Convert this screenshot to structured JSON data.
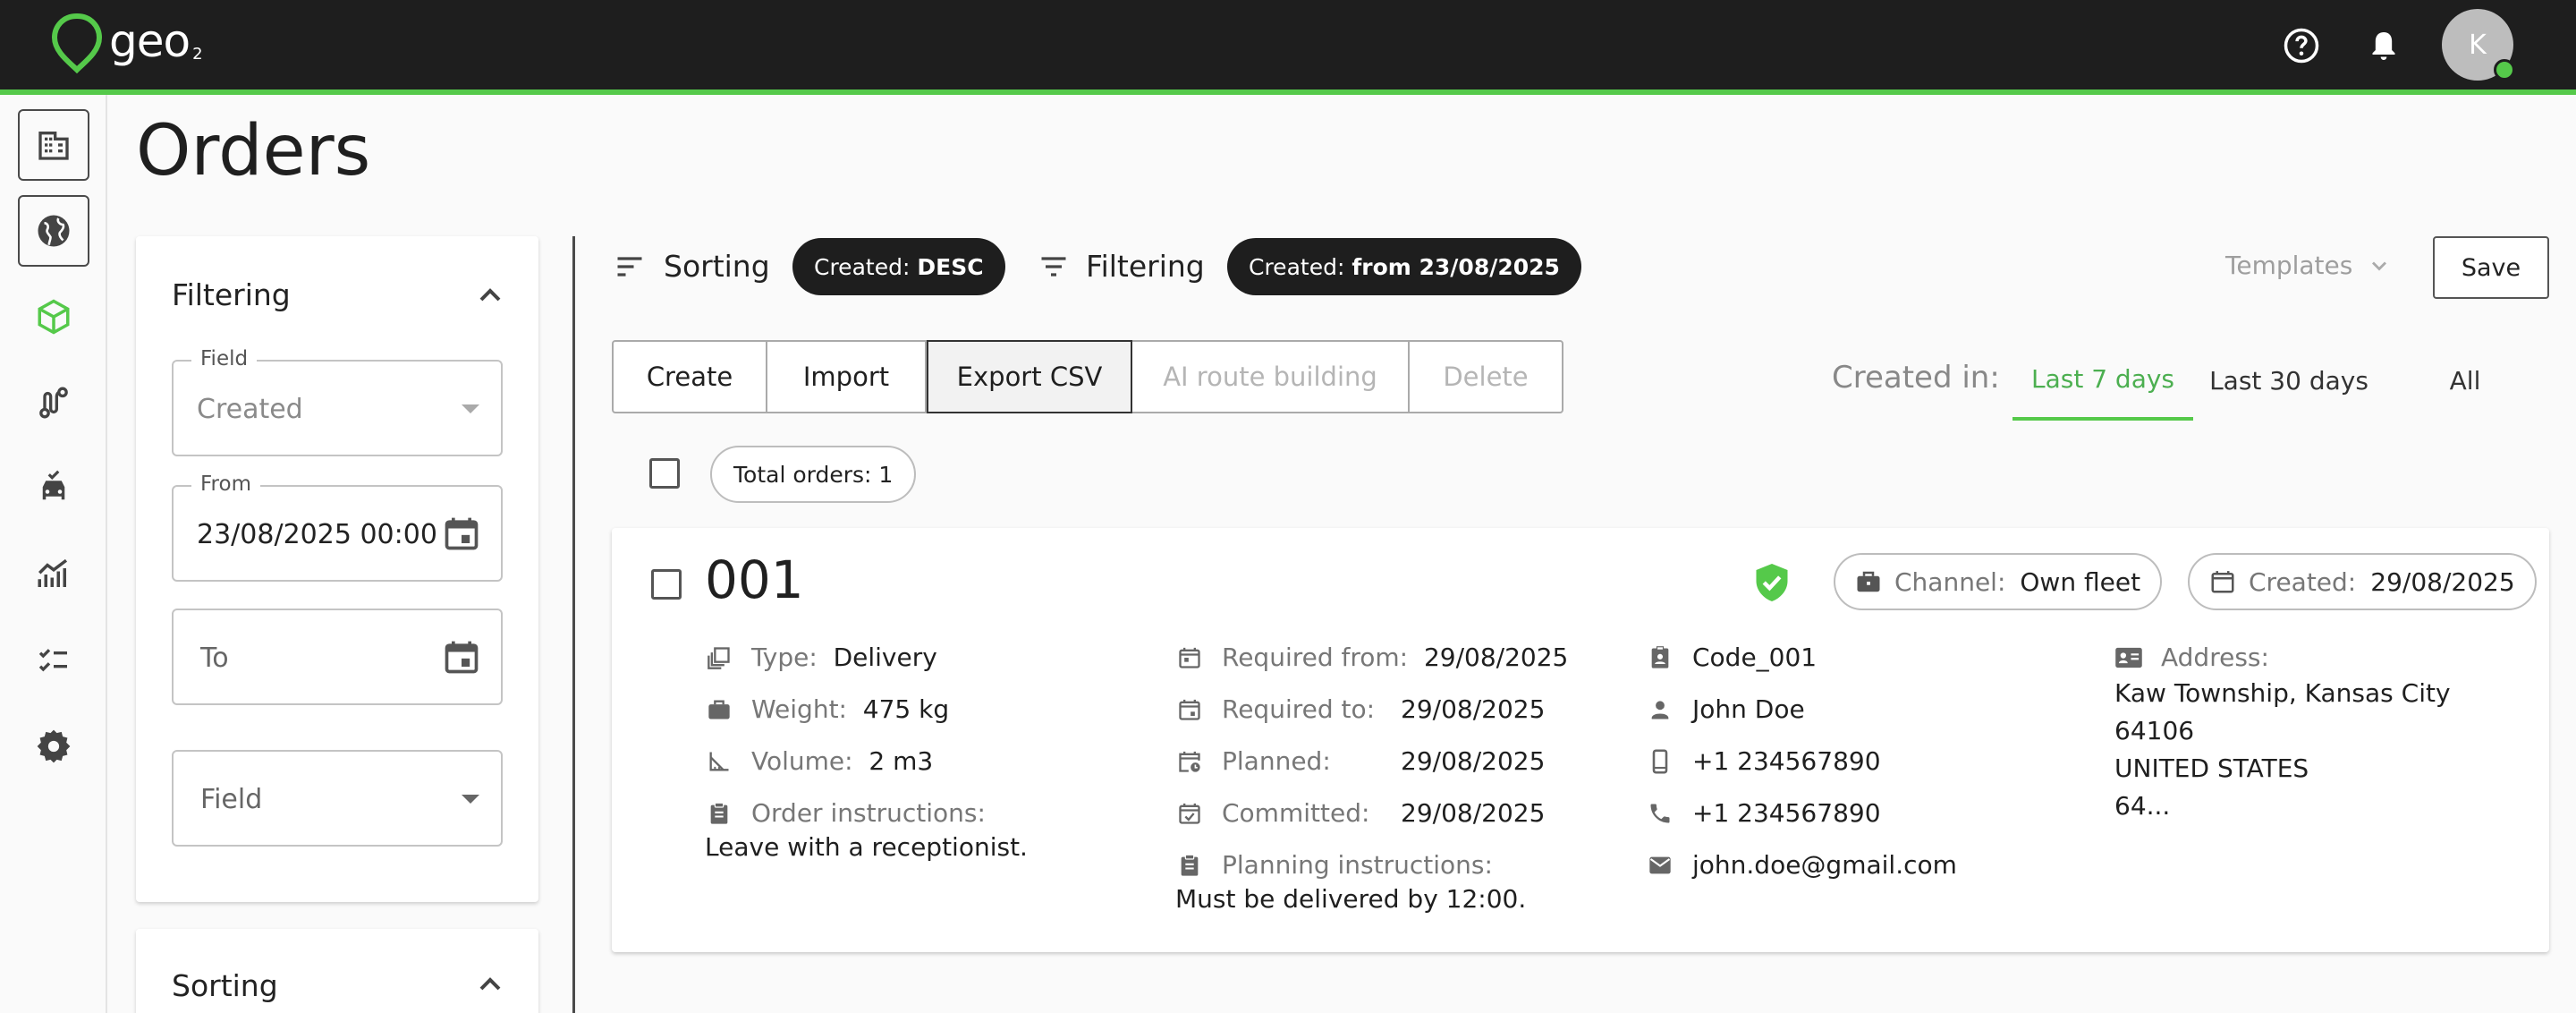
{
  "app": {
    "logo_text": "geo",
    "logo_sub": "2",
    "user_initial": "K"
  },
  "colors": {
    "accent": "#55c94a",
    "topbar": "#1e1e1e"
  },
  "sidebar_icons": [
    "buildings-icon",
    "globe-icon",
    "package-icon",
    "route-icon",
    "vehicle-icon",
    "analytics-icon",
    "checklist-icon",
    "gear-icon"
  ],
  "page": {
    "title": "Orders"
  },
  "filter_panel": {
    "title": "Filtering",
    "field": {
      "label": "Field",
      "value": "Created"
    },
    "from": {
      "label": "From",
      "value": "23/08/2025 00:00"
    },
    "to": {
      "placeholder": "To"
    },
    "field2": {
      "placeholder": "Field"
    },
    "sorting_title": "Sorting"
  },
  "toolbar": {
    "sorting_label": "Sorting",
    "sorting_chip_key": "Created:",
    "sorting_chip_value": "DESC",
    "filtering_label": "Filtering",
    "filtering_chip_key": "Created:",
    "filtering_chip_value": "from 23/08/2025",
    "templates_label": "Templates",
    "save_label": "Save"
  },
  "actions": {
    "create": "Create",
    "import": "Import",
    "export_csv": "Export CSV",
    "ai_route": "AI route building",
    "delete": "Delete"
  },
  "range": {
    "label": "Created in:",
    "last7": "Last 7 days",
    "last30": "Last 30 days",
    "all": "All"
  },
  "total_orders": "Total orders: 1",
  "order": {
    "number": "001",
    "channel_key": "Channel:",
    "channel_value": "Own fleet",
    "created_key": "Created:",
    "created_value": "29/08/2025",
    "type_key": "Type:",
    "type_value": "Delivery",
    "weight_key": "Weight:",
    "weight_value": "475 kg",
    "volume_key": "Volume:",
    "volume_value": "2 m3",
    "instructions_key": "Order instructions:",
    "instructions_value": "Leave with a receptionist.",
    "required_from_key": "Required from:",
    "required_from_value": "29/08/2025",
    "required_to_key": "Required to:",
    "required_to_value": "29/08/2025",
    "planned_key": "Planned:",
    "planned_value": "29/08/2025",
    "committed_key": "Committed:",
    "committed_value": "29/08/2025",
    "planning_key": "Planning instructions:",
    "planning_value": "Must be delivered by 12:00.",
    "code": "Code_001",
    "contact_name": "John Doe",
    "mobile": "+1 234567890",
    "phone": "+1 234567890",
    "email": "john.doe@gmail.com",
    "address_key": "Address:",
    "address_line1": "Kaw Township, Kansas City",
    "address_line2": "64106",
    "address_line3": "UNITED STATES",
    "address_line4": "64..."
  }
}
